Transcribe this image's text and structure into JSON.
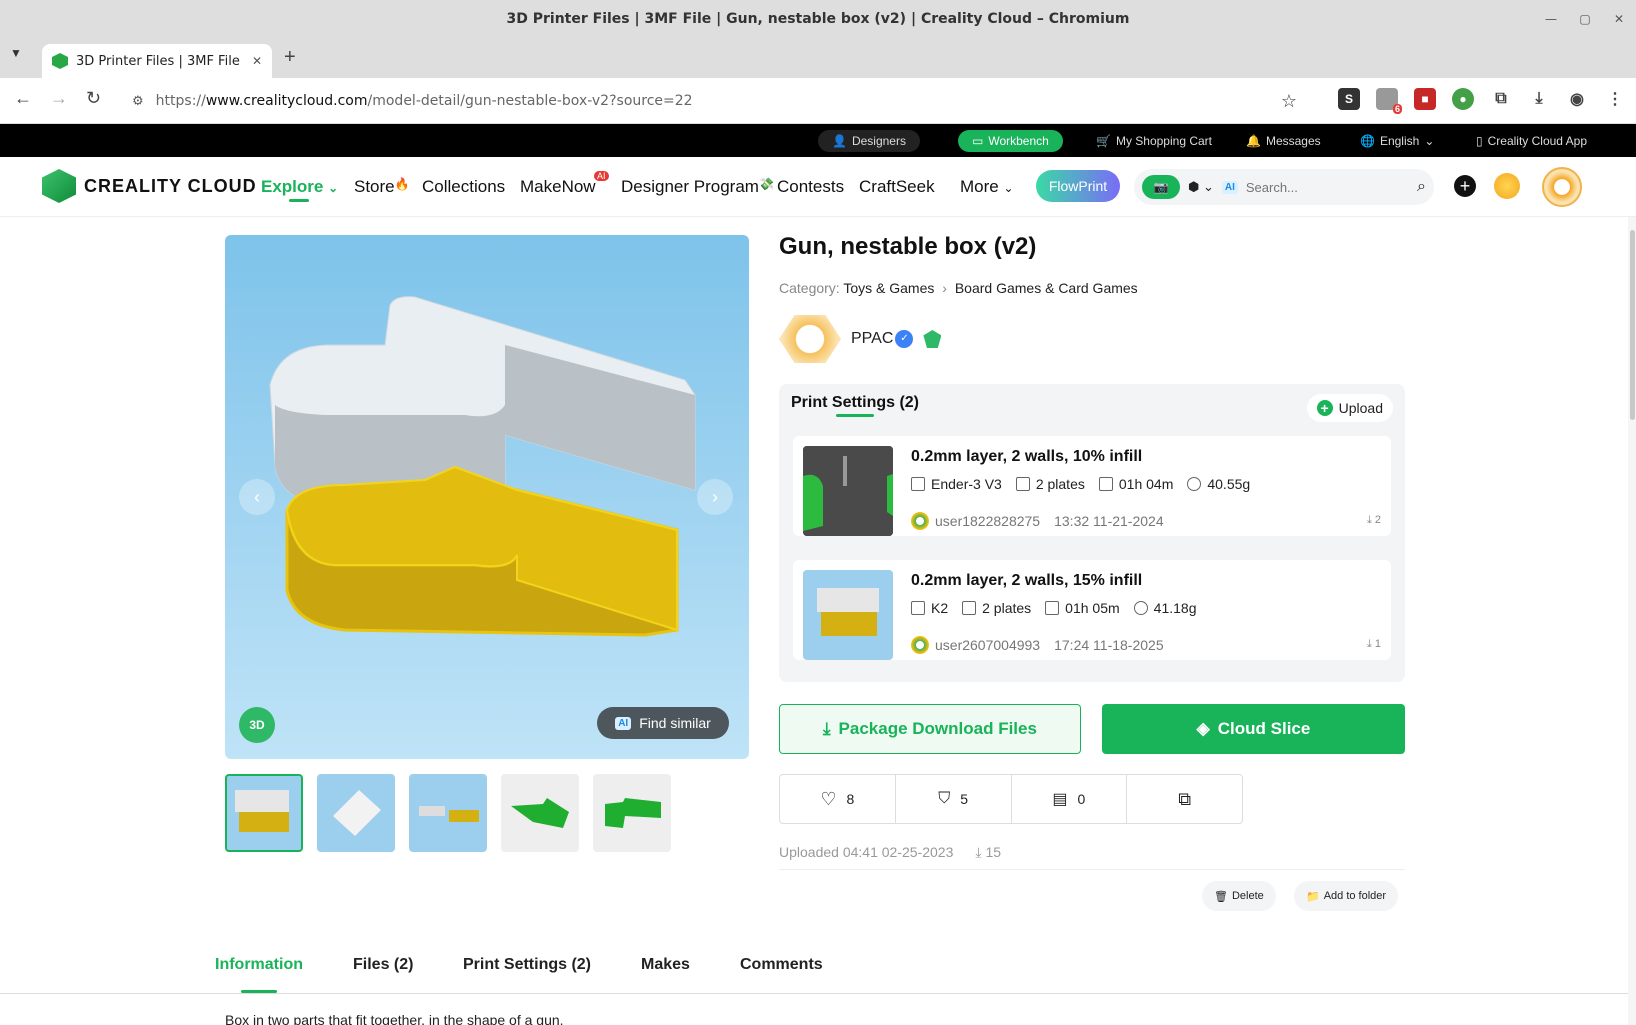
{
  "window": {
    "title": "3D Printer Files | 3MF File | Gun, nestable box (v2) | Creality Cloud – Chromium",
    "tab_title": "3D Printer Files | 3MF File | Gun, nestable box (v2)",
    "url_scheme": "https://",
    "url_host": "www.crealitycloud.com",
    "url_path": "/model-detail/gun-nestable-box-v2?source=22",
    "extension_badge": "6"
  },
  "topbar": {
    "designers": "Designers",
    "workbench": "Workbench",
    "cart": "My Shopping Cart",
    "messages": "Messages",
    "language": "English",
    "app": "Creality Cloud App"
  },
  "nav": {
    "logo": "CREALITY CLOUD",
    "explore": "Explore",
    "store": "Store",
    "collections": "Collections",
    "makenow": "MakeNow",
    "makenow_badge": "AI",
    "designer_program": "Designer Program",
    "contests": "Contests",
    "craftseek": "CraftSeek",
    "more": "More",
    "flowprint": "FlowPrint",
    "search_ai": "AI",
    "search_placeholder": "Search..."
  },
  "viewer": {
    "find_similar": "Find similar",
    "find_similar_ai": "AI",
    "rotate_label": "3D"
  },
  "model": {
    "title": "Gun, nestable box (v2)",
    "category_label": "Category:",
    "category": "Toys & Games",
    "subcategory": "Board Games & Card Games",
    "author": "PPAC"
  },
  "print_settings": {
    "title": "Print Settings (2)",
    "upload": "Upload",
    "items": [
      {
        "name": "0.2mm layer, 2 walls, 10% infill",
        "printer": "Ender-3 V3",
        "plates": "2 plates",
        "time": "01h 04m",
        "weight": "40.55g",
        "user": "user1822828275",
        "date": "13:32 11-21-2024",
        "downloads": "2"
      },
      {
        "name": "0.2mm layer, 2 walls, 15% infill",
        "printer": "K2",
        "plates": "2 plates",
        "time": "01h 05m",
        "weight": "41.18g",
        "user": "user2607004993",
        "date": "17:24 11-18-2025",
        "downloads": "1"
      }
    ]
  },
  "actions": {
    "package_download": "Package Download Files",
    "cloud_slice": "Cloud Slice",
    "likes": "8",
    "collects": "5",
    "comments": "0",
    "uploaded": "Uploaded 04:41 02-25-2023",
    "downloads": "15",
    "delete": "Delete",
    "add_to_folder": "Add to folder"
  },
  "tabs": [
    "Information",
    "Files (2)",
    "Print Settings (2)",
    "Makes",
    "Comments"
  ],
  "description": "Box in two parts that fit together, in the shape of a gun."
}
